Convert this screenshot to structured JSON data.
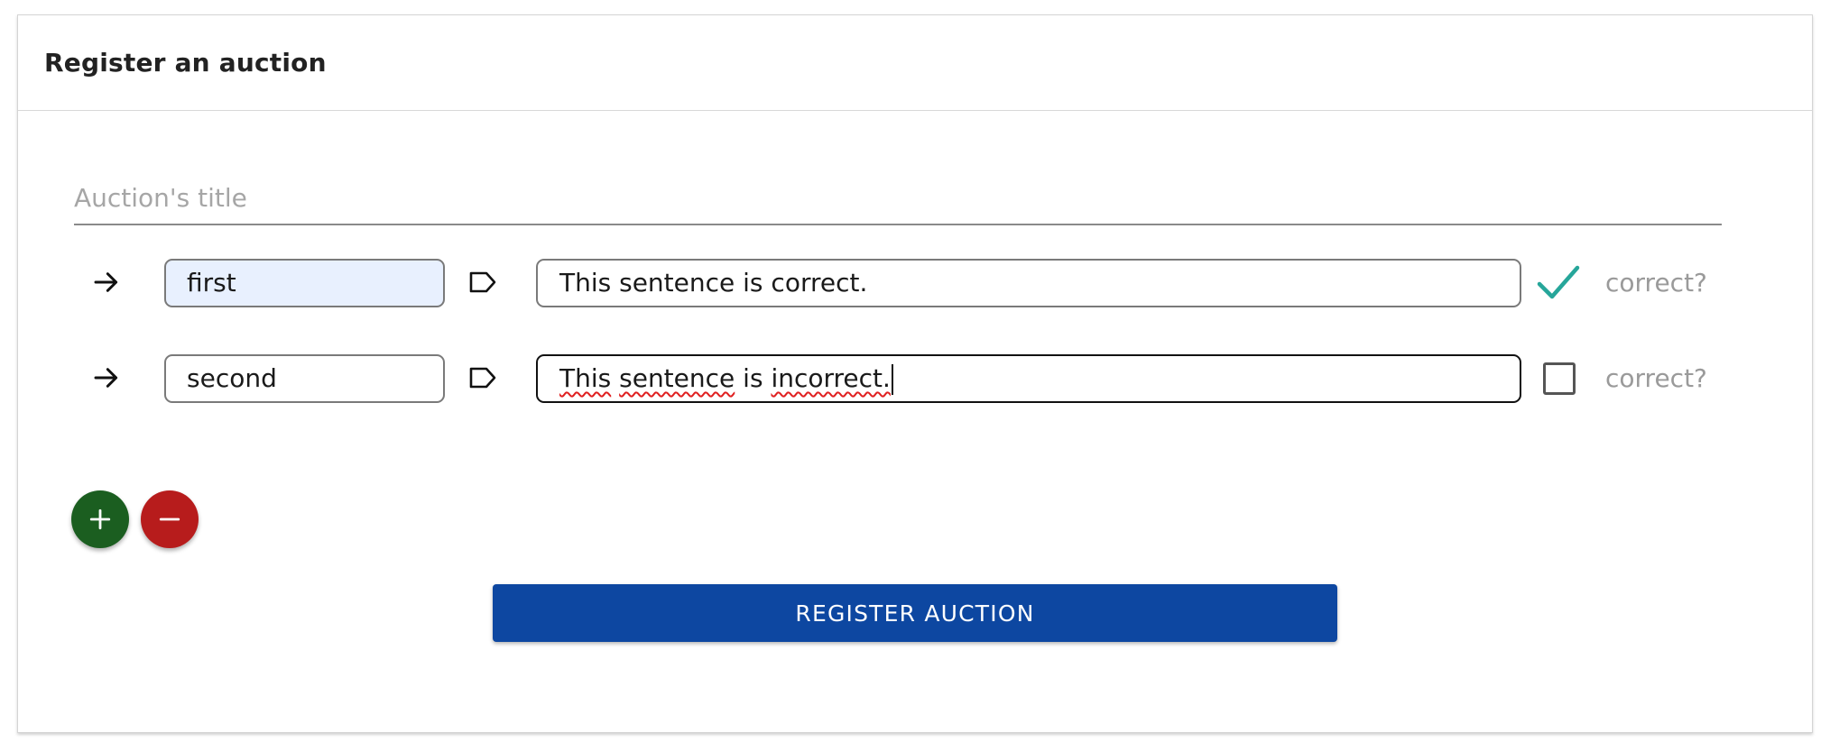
{
  "card": {
    "title": "Register an auction"
  },
  "form": {
    "title_placeholder": "Auction's title",
    "title_value": ""
  },
  "rows": [
    {
      "key": "first",
      "sentence": "This sentence is correct.",
      "correct": true,
      "correct_label": "correct?",
      "arrow_icon": "arrow-right-icon",
      "tag_icon": "label-outline-icon"
    },
    {
      "key": "second",
      "sentence_words": [
        "This",
        "sentence",
        "is",
        "incorrect."
      ],
      "sentence": "This sentence is incorrect.",
      "correct": false,
      "correct_label": "correct?",
      "arrow_icon": "arrow-right-icon",
      "tag_icon": "label-outline-icon"
    }
  ],
  "actions": {
    "add_icon": "plus-icon",
    "remove_icon": "minus-icon",
    "register_label": "REGISTER AUCTION"
  },
  "colors": {
    "add_button": "#1b5e20",
    "remove_button": "#b71c1c",
    "register_button": "#0d47a1",
    "check_mark": "#26a69a",
    "autofill_background": "#e8f0fe"
  }
}
